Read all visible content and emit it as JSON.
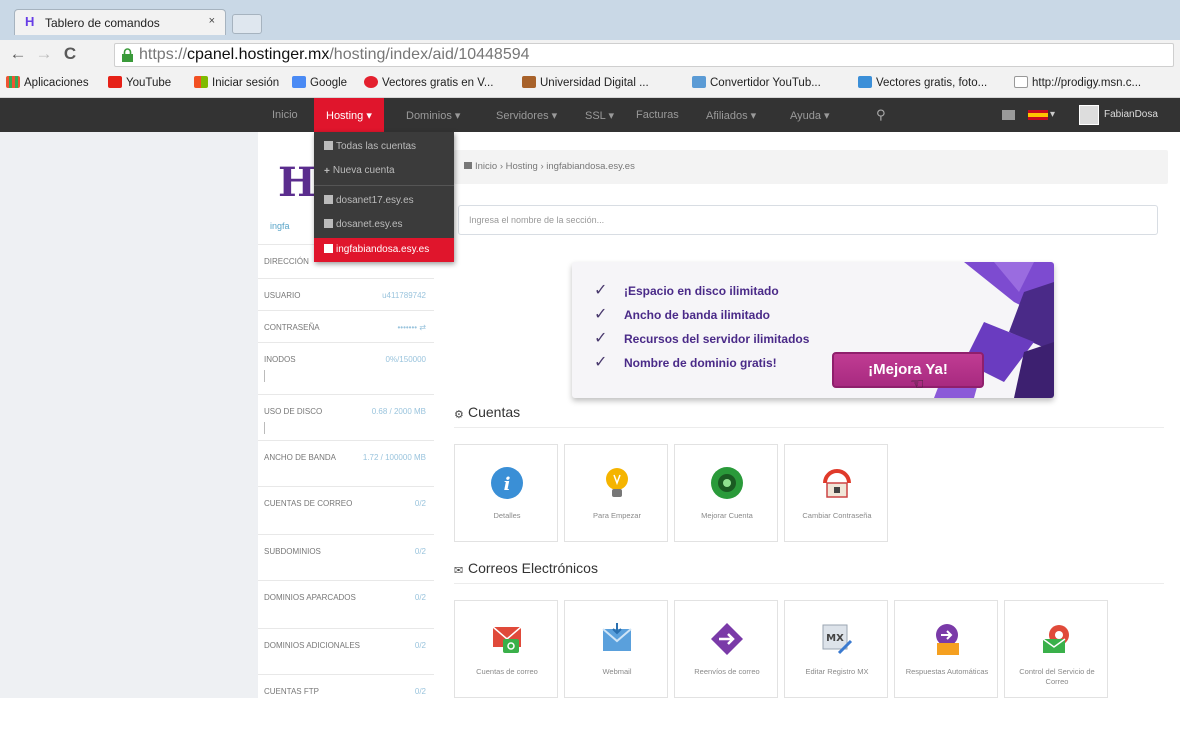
{
  "browser": {
    "tab_title": "Tablero de comandos",
    "tab_close": "×",
    "back": "←",
    "forward": "→",
    "reload": "C",
    "url_prefix": "https://",
    "url_host": "cpanel.hostinger.mx",
    "url_path": "/hosting/index/aid/10448594",
    "bookmarks": [
      "Aplicaciones",
      "YouTube",
      "Iniciar sesión",
      "Google",
      "Vectores gratis en V...",
      "Universidad Digital ...",
      "Convertidor YouTub...",
      "Vectores gratis, foto...",
      "http://prodigy.msn.c..."
    ]
  },
  "navbar": {
    "items": [
      "Inicio",
      "Hosting ▾",
      "Dominios ▾",
      "Servidores ▾",
      "SSL ▾",
      "Facturas",
      "Afiliados ▾",
      "Ayuda ▾"
    ],
    "search_icon": "search-icon",
    "lang": "▾",
    "user": "FabianDosa"
  },
  "dropdown": {
    "items": [
      "Todas las cuentas",
      "Nueva cuenta",
      "dosanet17.esy.es",
      "dosanet.esy.es",
      "ingfabiandosa.esy.es"
    ]
  },
  "sidebar": {
    "logo_sub": "ingfa",
    "rows": [
      {
        "label": "DIRECCIÓN",
        "value": ""
      },
      {
        "label": "USUARIO",
        "value": "u411789742"
      },
      {
        "label": "CONTRASEÑA",
        "value": "•••••••  ⇄"
      },
      {
        "label": "INODOS",
        "value": "0%/150000"
      },
      {
        "label": "USO DE DISCO",
        "value": "0.68 / 2000 MB"
      },
      {
        "label": "ANCHO DE BANDA",
        "value": "1.72 / 100000 MB"
      },
      {
        "label": "CUENTAS DE CORREO",
        "value": "0/2"
      },
      {
        "label": "SUBDOMINIOS",
        "value": "0/2"
      },
      {
        "label": "DOMINIOS APARCADOS",
        "value": "0/2"
      },
      {
        "label": "DOMINIOS ADICIONALES",
        "value": "0/2"
      },
      {
        "label": "CUENTAS FTP",
        "value": "0/2"
      }
    ]
  },
  "breadcrumb": "Inicio  ›  Hosting  ›  ingfabiandosa.esy.es",
  "search": {
    "placeholder": "Ingresa el nombre de la sección..."
  },
  "banner": {
    "lines": [
      "¡Espacio en disco ilimitado",
      "Ancho de banda ilimitado",
      "Recursos del servidor ilimitados",
      "Nombre de dominio gratis!"
    ],
    "button": "¡Mejora Ya!"
  },
  "sections": {
    "cuentas": {
      "title": "Cuentas",
      "tiles": [
        "Detalles",
        "Para Empezar",
        "Mejorar Cuenta",
        "Cambiar Contraseña"
      ]
    },
    "correos": {
      "title": "Correos Electrónicos",
      "tiles": [
        "Cuentas de correo",
        "Webmail",
        "Reenvíos de correo",
        "Editar Registro MX",
        "Respuestas Automáticas",
        "Control del Servicio de Correo"
      ]
    }
  },
  "colors": {
    "navbar_bg": "#333333",
    "active_red": "#e0152c",
    "promo_purple": "#a82a80"
  }
}
